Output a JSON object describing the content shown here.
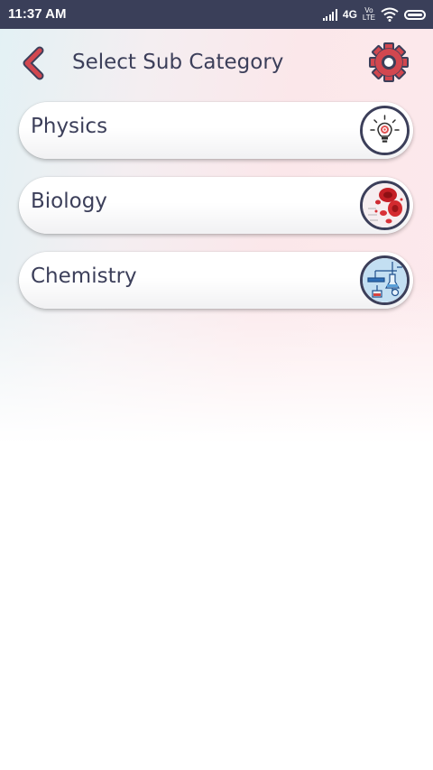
{
  "status_bar": {
    "time": "11:37 AM",
    "network": "4G",
    "volte_top": "Vo",
    "volte_bottom": "LTE"
  },
  "header": {
    "title": "Select Sub Category",
    "back_icon": "chevron-left-icon",
    "settings_icon": "gear-icon"
  },
  "categories": [
    {
      "label": "Physics",
      "icon": "lightbulb-target-icon"
    },
    {
      "label": "Biology",
      "icon": "blood-cells-icon"
    },
    {
      "label": "Chemistry",
      "icon": "lab-equipment-icon"
    }
  ],
  "colors": {
    "status_bar": "#3a3f59",
    "text": "#3c3f5a",
    "accent": "#d2474f"
  }
}
